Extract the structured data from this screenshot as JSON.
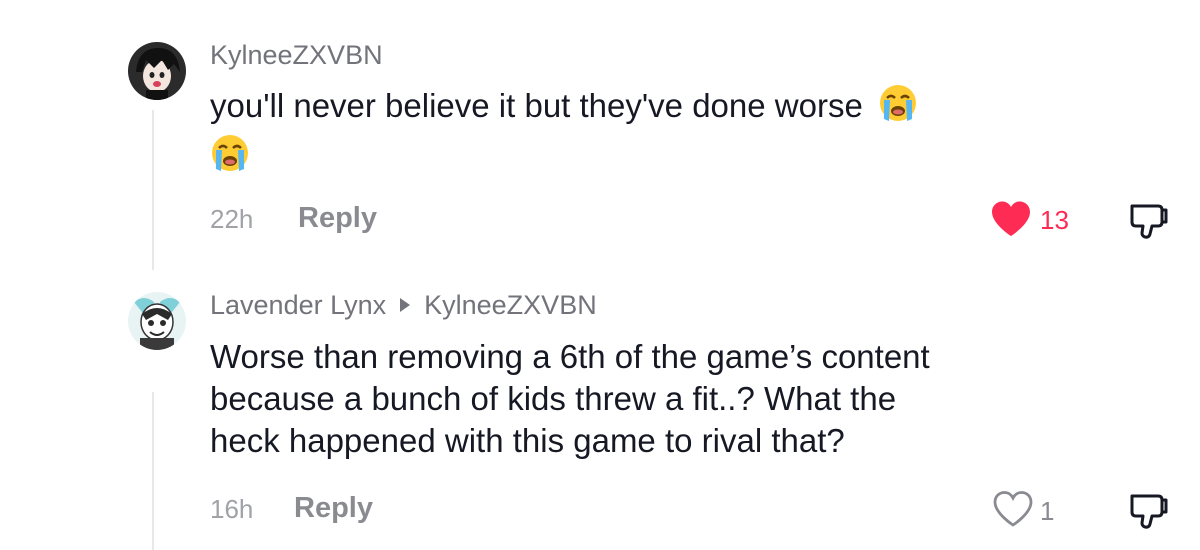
{
  "comments": [
    {
      "username": "KylneeZXVBN",
      "text": "you'll never believe it but they've done worse",
      "emoji": "loudly-crying-face",
      "time": "22h",
      "reply_label": "Reply",
      "likes": "13",
      "liked": true
    },
    {
      "username": "Lavender Lynx",
      "reply_to": "KylneeZXVBN",
      "text_line1": "Worse than removing a 6th of the game’s content",
      "text_line2": "because a bunch of kids threw a fit..? What the",
      "text_line3": "heck happened with this game to rival that?",
      "time": "16h",
      "reply_label": "Reply",
      "likes": "1",
      "liked": false
    }
  ],
  "colors": {
    "like_active": "#fe2c55",
    "muted": "#73747b",
    "text": "#161823"
  }
}
